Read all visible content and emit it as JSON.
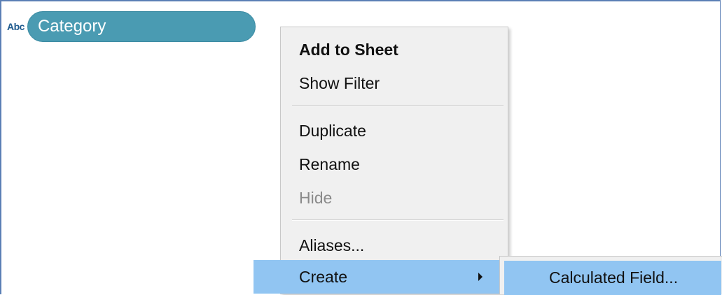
{
  "field": {
    "type_icon": "Abc",
    "name": "Category"
  },
  "context_menu": {
    "items": [
      {
        "label": "Add to Sheet",
        "style": "bold"
      },
      {
        "label": "Show Filter"
      },
      {
        "label": "Duplicate"
      },
      {
        "label": "Rename"
      },
      {
        "label": "Hide",
        "state": "disabled"
      },
      {
        "label": "Aliases..."
      },
      {
        "label": "Create",
        "state": "highlighted",
        "has_submenu": true
      }
    ]
  },
  "submenu": {
    "items": [
      {
        "label": "Calculated Field...",
        "state": "highlighted"
      }
    ]
  },
  "colors": {
    "pill": "#4a9bb2",
    "highlight": "#91c5f2",
    "menu_bg": "#f0f0f0",
    "frame_border": "#5b7fb5"
  }
}
